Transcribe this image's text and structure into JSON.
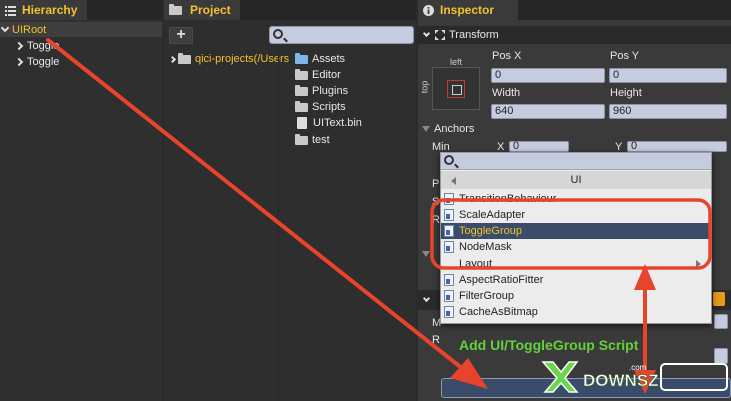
{
  "hierarchy": {
    "tab_label": "Hierarchy",
    "items": [
      {
        "label": "UIRoot",
        "expanded": true,
        "selected": true
      },
      {
        "label": "Toggle",
        "expanded": false
      },
      {
        "label": "Toggle",
        "expanded": false
      }
    ]
  },
  "project": {
    "tab_label": "Project",
    "add_label": "+",
    "search": {
      "value": "",
      "icon": "search-icon"
    },
    "tree": [
      {
        "label": "qici-projects(/Users"
      }
    ],
    "files": [
      {
        "label": "Assets",
        "icon": "assets-folder-icon"
      },
      {
        "label": "Editor",
        "icon": "folder-icon"
      },
      {
        "label": "Plugins",
        "icon": "folder-icon"
      },
      {
        "label": "Scripts",
        "icon": "folder-icon"
      },
      {
        "label": "UIText.bin",
        "icon": "file-icon"
      },
      {
        "label": "test",
        "icon": "folder-icon"
      }
    ]
  },
  "inspector": {
    "tab_label": "Inspector",
    "transform": {
      "title": "Transform",
      "anchor_left": "left",
      "anchor_top": "top",
      "pos_x_label": "Pos X",
      "pos_y_label": "Pos Y",
      "pos_x": "0",
      "pos_y": "0",
      "width_label": "Width",
      "height_label": "Height",
      "width": "640",
      "height": "960"
    },
    "anchors": {
      "title": "Anchors",
      "min_label": "Min",
      "x_label": "X",
      "y_label": "Y",
      "min_x": "0",
      "min_y": "0"
    },
    "partial_labels": [
      "Pi",
      "Sc",
      "R",
      "M",
      "R"
    ]
  },
  "dropdown": {
    "search_value": "",
    "header": "UI",
    "items": [
      {
        "label": "TransitionBehaviour",
        "icon": "script-icon"
      },
      {
        "label": "ScaleAdapter",
        "icon": "script-icon"
      },
      {
        "label": "ToggleGroup",
        "icon": "script-icon",
        "selected": true
      },
      {
        "label": "NodeMask",
        "icon": "script-icon"
      },
      {
        "label": "Layout",
        "icon": "",
        "submenu": true
      },
      {
        "label": "AspectRatioFitter",
        "icon": "script-icon"
      },
      {
        "label": "FilterGroup",
        "icon": "script-icon"
      },
      {
        "label": "CacheAsBitmap",
        "icon": "script-icon"
      }
    ]
  },
  "annotation": {
    "text": "Add UI/ToggleGroup Script",
    "arrow_color": "#e8432b",
    "text_color": "#62d13a"
  },
  "watermark": {
    "text": "DOWNSZ.com",
    "brand_color": "#6ad64a"
  },
  "colors": {
    "accent": "#f3c22c",
    "selection": "#3b4b6a",
    "field": "#c6cce0"
  }
}
